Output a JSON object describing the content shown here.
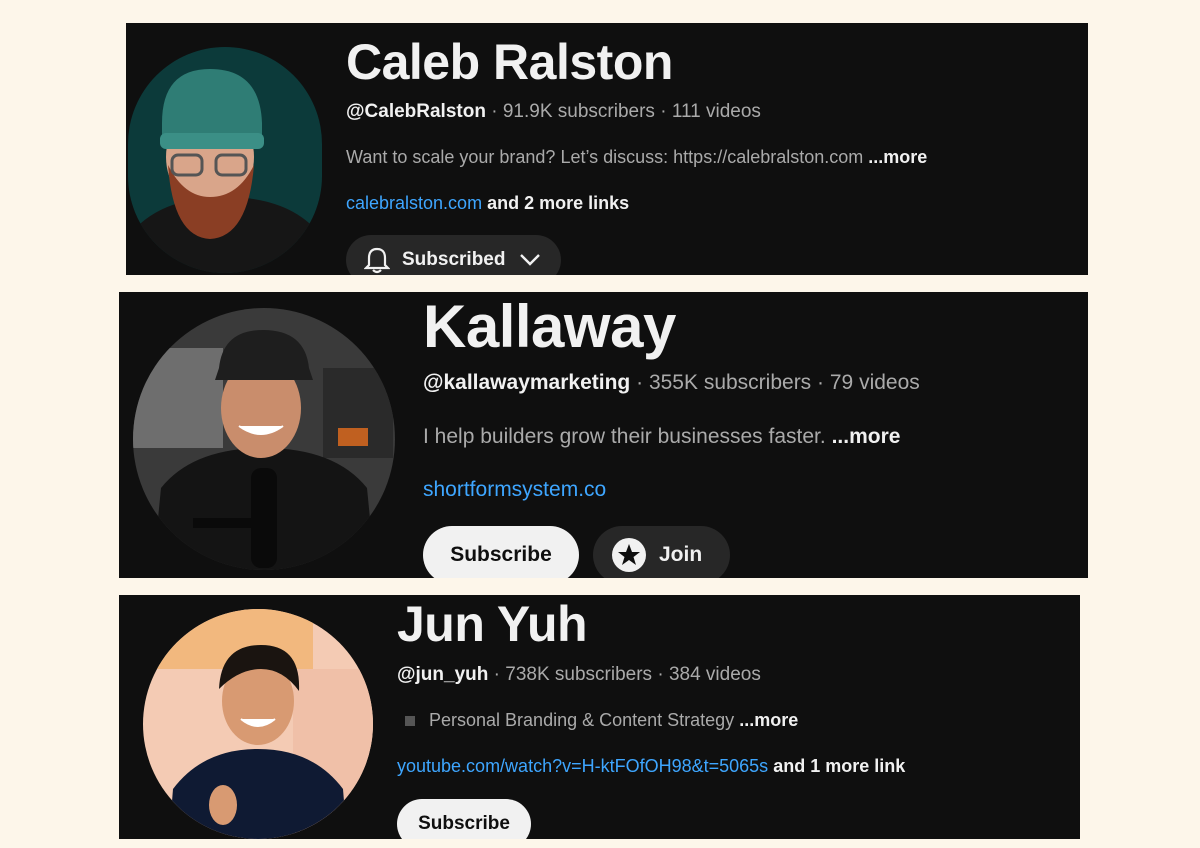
{
  "channels": [
    {
      "name": "Caleb Ralston",
      "handle": "@CalebRalston",
      "subscribers": "91.9K subscribers",
      "videos": "111 videos",
      "description": "Want to scale your brand? Let’s discuss: https://calebralston.com",
      "more": "...more",
      "link": "calebralston.com",
      "link_extra": "and 2 more links",
      "subscribe_label": "Subscribed",
      "avatar_icon": "person-beanie-beard-icon"
    },
    {
      "name": "Kallaway",
      "handle": "@kallawaymarketing",
      "subscribers": "355K subscribers",
      "videos": "79 videos",
      "description": "I help builders grow their businesses faster.",
      "more": "...more",
      "link": "shortformsystem.co",
      "subscribe_label": "Subscribe",
      "join_label": "Join",
      "avatar_icon": "person-cap-microphone-icon"
    },
    {
      "name": "Jun Yuh",
      "handle": "@jun_yuh",
      "subscribers": "738K subscribers",
      "videos": "384 videos",
      "description": "Personal Branding & Content Strategy",
      "more": "...more",
      "link": "youtube.com/watch?v=H-ktFOfOH98&t=5065s",
      "link_extra": "and 1 more link",
      "subscribe_label": "Subscribe",
      "avatar_icon": "person-smiling-icon"
    }
  ],
  "separator": "·",
  "colors": {
    "page_bg": "#fdf6ea",
    "panel_bg": "#0f0f0f",
    "link": "#3ea6ff",
    "secondary_text": "#aaaaaa"
  }
}
